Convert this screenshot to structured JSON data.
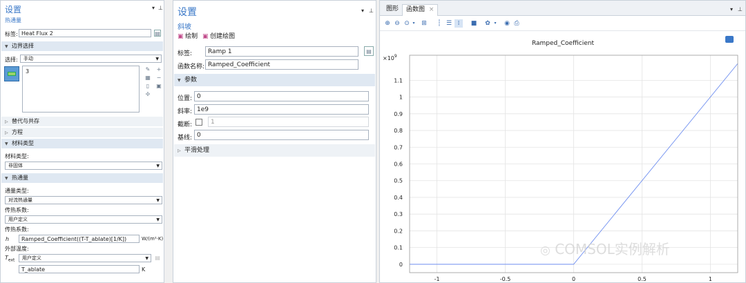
{
  "left_panel": {
    "title": "设置",
    "subtitle": "热通量",
    "label_caption": "标签:",
    "label_value": "Heat Flux 2",
    "boundary_section": "边界选择",
    "selection_caption": "选择:",
    "selection_value": "手动",
    "selection_list": [
      "3"
    ],
    "override_section": "替代与共存",
    "equation_section": "方程",
    "material_section": "材料类型",
    "material_type_caption": "材料类型:",
    "material_type_value": "非固体",
    "heatflux_section": "热通量",
    "flux_type_caption": "通量类型:",
    "flux_type_value": "对流热通量",
    "htc_caption_1": "传热系数:",
    "htc_select_value": "用户定义",
    "htc_caption_2": "传热系数:",
    "h_symbol": "h",
    "h_value": "Ramped_Coefficient((T-T_ablate)[1/K])",
    "h_unit": "W/(m²·K)",
    "ext_temp_caption": "外部温度:",
    "t_symbol": "T",
    "t_sub": "ext",
    "text_select_value": "用户定义",
    "text_value": "T_ablate",
    "text_unit": "K"
  },
  "middle_panel": {
    "title": "设置",
    "subtitle": "斜坡",
    "plot_button": "绘制",
    "create_plot_button": "创建绘图",
    "label_caption": "标签:",
    "label_value": "Ramp 1",
    "func_name_caption": "函数名称:",
    "func_name_value": "Ramped_Coefficient",
    "params_section": "参数",
    "location_caption": "位置:",
    "location_value": "0",
    "slope_caption": "斜率:",
    "slope_value": "1e9",
    "cutoff_caption": "截断:",
    "cutoff_value": "1",
    "baseline_caption": "基线:",
    "baseline_value": "0",
    "smoothing_section": "平滑处理"
  },
  "right_panel": {
    "tabs": [
      "图形",
      "函数图"
    ],
    "tab_close": "×",
    "watermark": "COMSOL实例解析"
  },
  "chart_data": {
    "type": "line",
    "title": "Ramped_Coefficient",
    "y_multiplier": "×10",
    "y_multiplier_exp": "9",
    "xlim": [
      -1.2,
      1.2
    ],
    "ylim": [
      -0.05,
      1.25
    ],
    "x_ticks": [
      -1,
      -0.5,
      0,
      0.5,
      1
    ],
    "x_tick_labels": [
      "-1",
      "-0.5",
      "0",
      "0.5",
      "1"
    ],
    "y_ticks": [
      0,
      0.1,
      0.2,
      0.3,
      0.4,
      0.5,
      0.6,
      0.7,
      0.8,
      0.9,
      1,
      1.1
    ],
    "y_tick_labels": [
      "0",
      "0.1",
      "0.2",
      "0.3",
      "0.4",
      "0.5",
      "0.6",
      "0.7",
      "0.8",
      "0.9",
      "1",
      "1.1"
    ],
    "grid": true,
    "color": "#6f8ff0",
    "series": [
      {
        "x": [
          -1.2,
          0,
          1.2
        ],
        "y": [
          0,
          0,
          1.2
        ]
      }
    ]
  }
}
